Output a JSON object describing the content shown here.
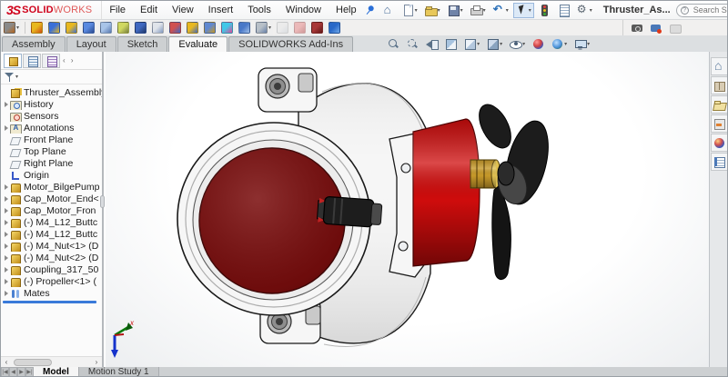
{
  "window": {
    "doc_title": "Thruster_As...",
    "brand": {
      "swoosh": "3S",
      "name_bold": "SOLID",
      "name_light": "WORKS"
    }
  },
  "menubar": {
    "items": [
      "File",
      "Edit",
      "View",
      "Insert",
      "Tools",
      "Window",
      "Help"
    ]
  },
  "quick_access": [
    {
      "name": "home",
      "dropdown": false
    },
    {
      "name": "new-document",
      "dropdown": true
    },
    {
      "name": "open-document",
      "dropdown": true
    },
    {
      "name": "save",
      "dropdown": true
    },
    {
      "name": "print",
      "dropdown": true
    },
    {
      "name": "undo",
      "dropdown": true
    },
    {
      "name": "select",
      "dropdown": true,
      "active": true
    },
    {
      "name": "rebuild-traffic-light",
      "dropdown": false
    },
    {
      "name": "file-properties",
      "dropdown": false
    },
    {
      "name": "options-gear",
      "dropdown": true
    }
  ],
  "search": {
    "placeholder": "Search SOLIDWORKS Help"
  },
  "window_controls": [
    {
      "name": "user",
      "glyph": ""
    },
    {
      "name": "help",
      "glyph": "?",
      "dropdown": true
    },
    {
      "name": "minimize",
      "glyph": "−"
    },
    {
      "name": "restore",
      "glyph": ""
    },
    {
      "name": "close",
      "glyph": "×"
    }
  ],
  "command_toolbar": {
    "left": [
      {
        "name": "evaluate-tools",
        "c1": "#8a8a8a",
        "c2": "#b5651d",
        "dropdown": true,
        "sep_after": true
      },
      {
        "name": "insert-components",
        "c1": "#e8b820",
        "c2": "#d04a12"
      },
      {
        "name": "mate",
        "c1": "#3a6fd8",
        "c2": "#e8b820"
      },
      {
        "name": "linear-component-pattern",
        "c1": "#e8b820",
        "c2": "#3a6fd8"
      },
      {
        "name": "smart-fasteners",
        "c1": "#5a8ae0",
        "c2": "#2a4a90"
      },
      {
        "name": "move-component",
        "c1": "#a8c4e8",
        "c2": "#5878b0"
      },
      {
        "name": "show-hidden-components",
        "c1": "#d0d860",
        "c2": "#788040"
      },
      {
        "name": "assembly-features",
        "c1": "#4068c0",
        "c2": "#203868"
      },
      {
        "name": "reference-geometry",
        "c1": "#e0e4ea",
        "c2": "#8098c0"
      },
      {
        "name": "new-motion-study",
        "c1": "#d05050",
        "c2": "#4068c0"
      },
      {
        "name": "bill-of-materials",
        "c1": "#e8b820",
        "c2": "#4068c0"
      },
      {
        "name": "exploded-view",
        "c1": "#6088d0",
        "c2": "#c89820"
      },
      {
        "name": "instant3d",
        "c1": "#40c8e8",
        "c2": "#e04898"
      },
      {
        "name": "update-speedpak",
        "c1": "#4878c8",
        "c2": "#a0c0e8"
      },
      {
        "name": "take-snapshot",
        "c1": "#b8c0c8",
        "c2": "#6880a8",
        "dropdown": true
      },
      {
        "name": "large-design-review",
        "c1": "#e8e8e8",
        "c2": "#c0c8d0",
        "disabled": true
      },
      {
        "name": "render-tools",
        "c1": "#e87878",
        "c2": "#a83030",
        "disabled": true
      },
      {
        "name": "pack-and-go",
        "c1": "#a83838",
        "c2": "#601818"
      },
      {
        "name": "edrawings",
        "c1": "#2868c8",
        "c2": "#70a8e8"
      }
    ],
    "capture": [
      {
        "name": "screen-capture"
      },
      {
        "name": "record-video"
      },
      {
        "name": "animation-disabled"
      }
    ]
  },
  "ribbon_tabs": {
    "items": [
      {
        "label": "Assembly",
        "active": false
      },
      {
        "label": "Layout",
        "active": false
      },
      {
        "label": "Sketch",
        "active": false
      },
      {
        "label": "Evaluate",
        "active": true
      },
      {
        "label": "SOLIDWORKS Add-Ins",
        "active": false
      }
    ]
  },
  "headsup_toolbar": [
    {
      "name": "zoom-to-fit",
      "dropdown": false
    },
    {
      "name": "zoom-to-area",
      "dropdown": false
    },
    {
      "name": "previous-view",
      "dropdown": false
    },
    {
      "name": "section-view",
      "dropdown": false
    },
    {
      "name": "view-orientation",
      "dropdown": true
    },
    {
      "name": "display-style",
      "dropdown": true
    },
    {
      "name": "hide-show-items",
      "dropdown": true
    },
    {
      "name": "edit-appearance",
      "dropdown": false
    },
    {
      "name": "apply-scene",
      "dropdown": true
    },
    {
      "name": "view-settings",
      "dropdown": true
    }
  ],
  "feature_panel": {
    "tabs": [
      {
        "name": "featuremanager",
        "active": true
      },
      {
        "name": "propertymanager",
        "active": false
      },
      {
        "name": "configurationmanager",
        "active": false
      }
    ],
    "overflow_glyph": "‹ ›",
    "tree": [
      {
        "label": "Thruster_Assembly",
        "icon": "assembly",
        "arrow": false,
        "root": true
      },
      {
        "label": "History",
        "icon": "history",
        "arrow": true
      },
      {
        "label": "Sensors",
        "icon": "sensors",
        "arrow": false
      },
      {
        "label": "Annotations",
        "icon": "annotations",
        "arrow": true
      },
      {
        "label": "Front Plane",
        "icon": "plane",
        "arrow": false
      },
      {
        "label": "Top Plane",
        "icon": "plane",
        "arrow": false
      },
      {
        "label": "Right Plane",
        "icon": "plane",
        "arrow": false
      },
      {
        "label": "Origin",
        "icon": "origin",
        "arrow": false
      },
      {
        "label": "Motor_BilgePump",
        "icon": "part",
        "arrow": true
      },
      {
        "label": "Cap_Motor_End<",
        "icon": "part",
        "arrow": true
      },
      {
        "label": "Cap_Motor_Fron",
        "icon": "part",
        "arrow": true
      },
      {
        "label": "(-) M4_L12_Buttc",
        "icon": "part",
        "arrow": true
      },
      {
        "label": "(-) M4_L12_Buttc",
        "icon": "part",
        "arrow": true
      },
      {
        "label": "(-) M4_Nut<1> (D",
        "icon": "part",
        "arrow": true
      },
      {
        "label": "(-) M4_Nut<2> (D",
        "icon": "part",
        "arrow": true
      },
      {
        "label": "Coupling_317_50",
        "icon": "part",
        "arrow": true
      },
      {
        "label": "(-) Propeller<1> (",
        "icon": "part",
        "arrow": true
      },
      {
        "label": "Mates",
        "icon": "mates",
        "arrow": true
      }
    ]
  },
  "task_pane": [
    {
      "name": "solidworks-resources-home"
    },
    {
      "name": "design-library"
    },
    {
      "name": "file-explorer"
    },
    {
      "name": "view-palette"
    },
    {
      "name": "appearances-scenes"
    },
    {
      "name": "custom-properties"
    }
  ],
  "bottom_bar": {
    "nav": [
      "|◀",
      "◀",
      "▶",
      "▶|"
    ],
    "tabs": [
      {
        "label": "Model",
        "active": true
      },
      {
        "label": "Motion Study 1",
        "active": false
      }
    ]
  },
  "viewport": {
    "triad_x_label": "x"
  },
  "model": {
    "colors": {
      "housing": "#f6f6f6",
      "front_disc": "#7a0d0d",
      "motor": "#cf0c0c",
      "coupling": "#c79a2a",
      "propeller": "#1c1c1c",
      "accent_rollback": "#3a7ad9"
    }
  }
}
